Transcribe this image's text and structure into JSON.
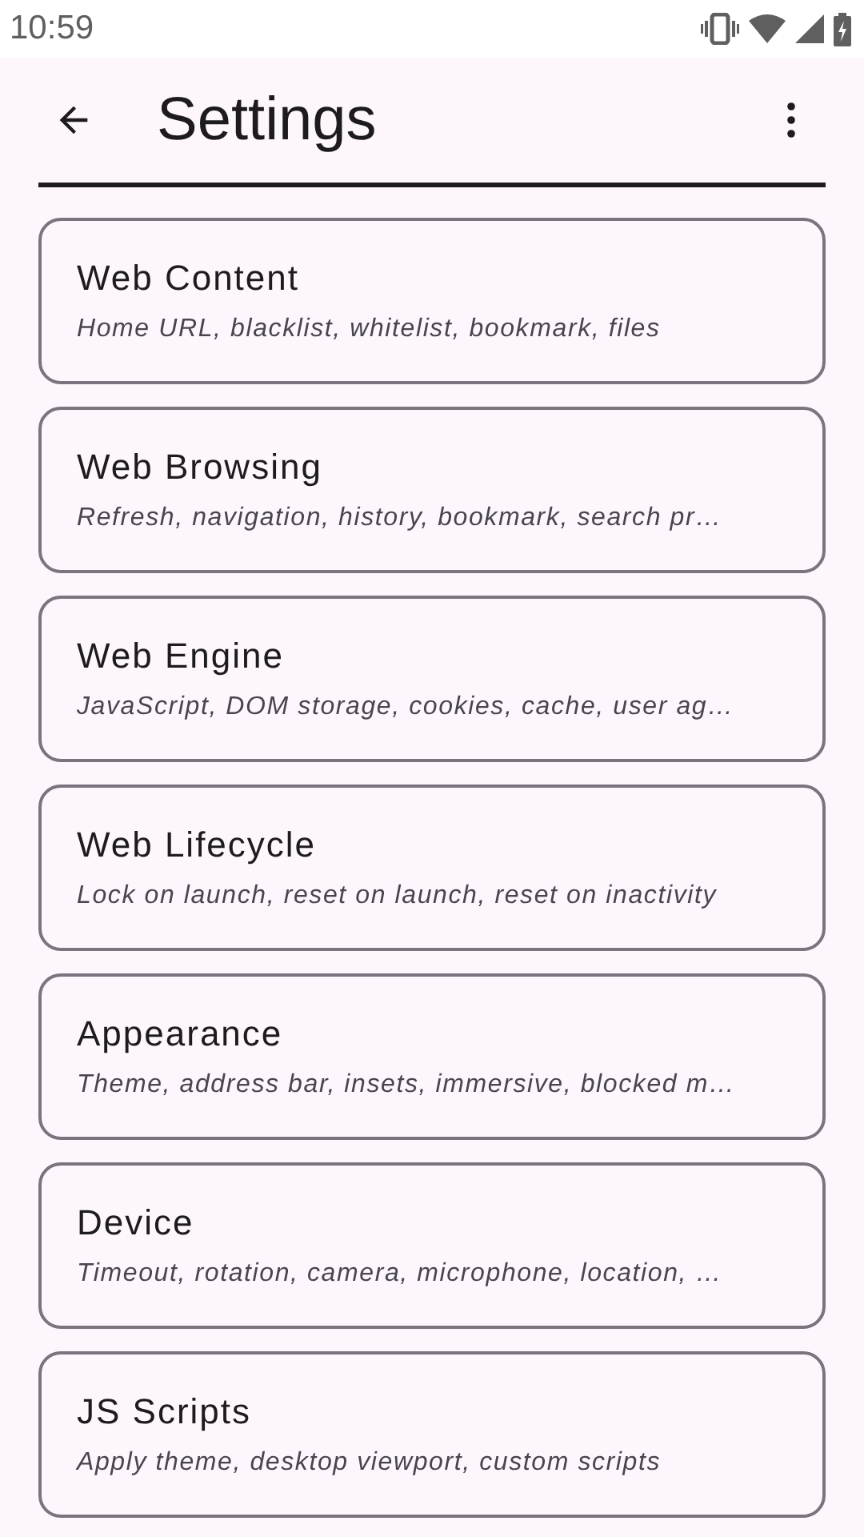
{
  "status_bar": {
    "time": "10:59"
  },
  "app_bar": {
    "title": "Settings"
  },
  "items": [
    {
      "title": "Web Content",
      "subtitle": "Home URL, blacklist, whitelist, bookmark, files"
    },
    {
      "title": "Web Browsing",
      "subtitle": "Refresh, navigation, history, bookmark, search pr…"
    },
    {
      "title": "Web Engine",
      "subtitle": "JavaScript, DOM storage, cookies, cache, user ag…"
    },
    {
      "title": "Web Lifecycle",
      "subtitle": "Lock on launch, reset on launch, reset on inactivity"
    },
    {
      "title": "Appearance",
      "subtitle": "Theme, address bar, insets, immersive, blocked m…"
    },
    {
      "title": "Device",
      "subtitle": "Timeout, rotation, camera, microphone, location, …"
    },
    {
      "title": "JS Scripts",
      "subtitle": "Apply theme, desktop viewport, custom scripts"
    }
  ]
}
